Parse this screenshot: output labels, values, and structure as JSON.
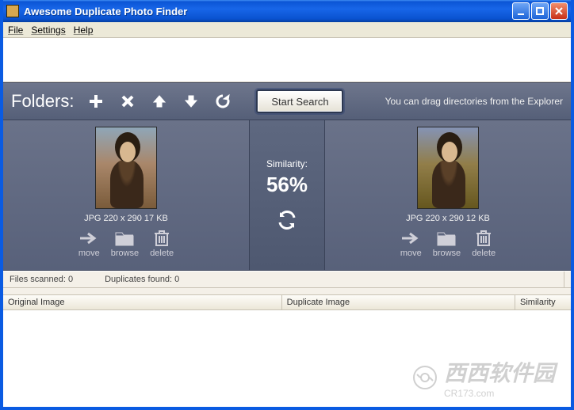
{
  "window": {
    "title": "Awesome Duplicate Photo Finder"
  },
  "menu": {
    "file": "File",
    "settings": "Settings",
    "help": "Help"
  },
  "toolbar": {
    "folders_label": "Folders:",
    "start_label": "Start Search",
    "hint": "You can drag directories from the Explorer"
  },
  "similarity": {
    "label": "Similarity:",
    "value": "56%"
  },
  "left": {
    "meta": "JPG  220 x 290  17 KB",
    "move": "move",
    "browse": "browse",
    "delete": "delete"
  },
  "right": {
    "meta": "JPG  220 x 290  12 KB",
    "move": "move",
    "browse": "browse",
    "delete": "delete"
  },
  "status": {
    "scanned": "Files scanned: 0",
    "duplicates": "Duplicates found: 0"
  },
  "columns": {
    "original": "Original Image",
    "duplicate": "Duplicate Image",
    "similarity": "Similarity"
  },
  "watermark": {
    "text": "西西软件园",
    "url": "CR173.com"
  }
}
